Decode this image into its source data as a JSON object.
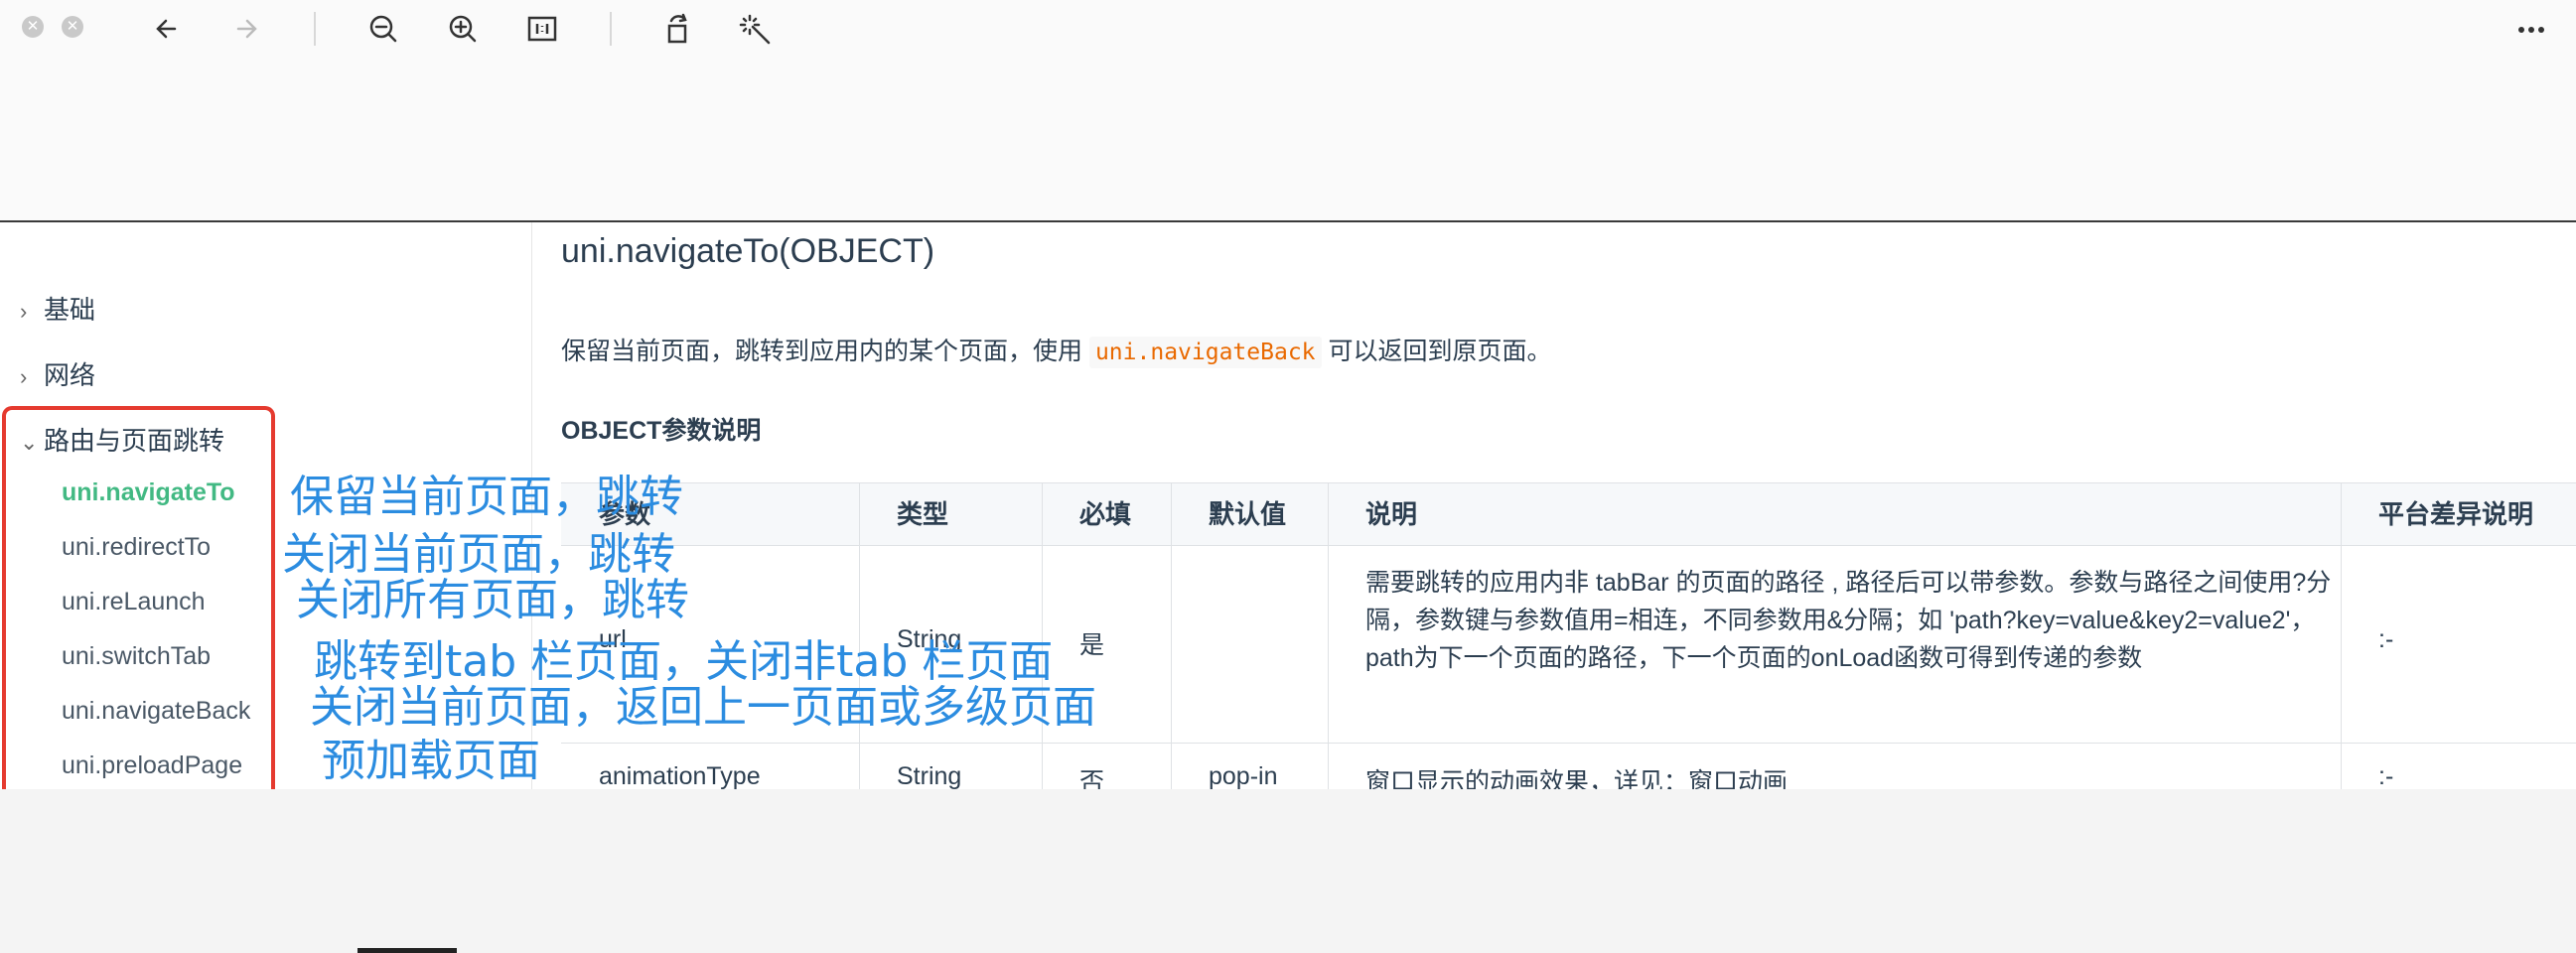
{
  "toolbar": {
    "close_glyph": "✕",
    "minimize_glyph": "✕",
    "icons": [
      "back-arrow-icon",
      "forward-arrow-icon",
      "zoom-out-icon",
      "zoom-in-icon",
      "actual-size-icon",
      "rotate-icon",
      "magic-wand-icon",
      "more-icon"
    ]
  },
  "sidebar": {
    "categories": [
      {
        "label": "基础",
        "expanded": false
      },
      {
        "label": "网络",
        "expanded": false
      },
      {
        "label": "路由与页面跳转",
        "expanded": true
      }
    ],
    "items": [
      {
        "label": "uni.navigateTo",
        "active": true
      },
      {
        "label": "uni.redirectTo"
      },
      {
        "label": "uni.reLaunch"
      },
      {
        "label": "uni.switchTab"
      },
      {
        "label": "uni.navigateBack"
      },
      {
        "label": "uni.preloadPage"
      }
    ]
  },
  "main": {
    "title": "uni.navigateTo(OBJECT)",
    "desc_before": "保留当前页面，跳转到应用内的某个页面，使用 ",
    "desc_code": "uni.navigateBack",
    "desc_after": " 可以返回到原页面。",
    "section_heading": "OBJECT参数说明",
    "table": {
      "headers": [
        "参数",
        "类型",
        "必填",
        "默认值",
        "说明",
        "平台差异说明"
      ],
      "row1": {
        "param": "url",
        "type": "String",
        "required": "是",
        "default": "",
        "desc": "需要跳转的应用内非 tabBar 的页面的路径 , 路径后可以带参数。参数与路径之间使用?分隔，参数键与参数值用=相连，不同参数用&分隔；如 'path?key=value&key2=value2'，path为下一个页面的路径，下一个页面的onLoad函数可得到传递的参数",
        "platform": ":-"
      },
      "row2": {
        "param": "animationType",
        "type": "String",
        "required": "否",
        "default": "pop-in",
        "desc": "窗口显示的动画效果，详见：窗口动画",
        "platform": ":-"
      }
    }
  },
  "annotations": [
    "保留当前页面，跳转",
    "关闭当前页面，跳转",
    "关闭所有页面，跳转",
    "跳转到tab 栏页面，关闭非tab 栏页面",
    "关闭当前页面，返回上一页面或多级页面",
    "预加载页面"
  ],
  "colors": {
    "active_link": "#42b983",
    "code": "#e96900",
    "annotation": "#2b8ce0",
    "highlight_box": "#e53a2f"
  }
}
